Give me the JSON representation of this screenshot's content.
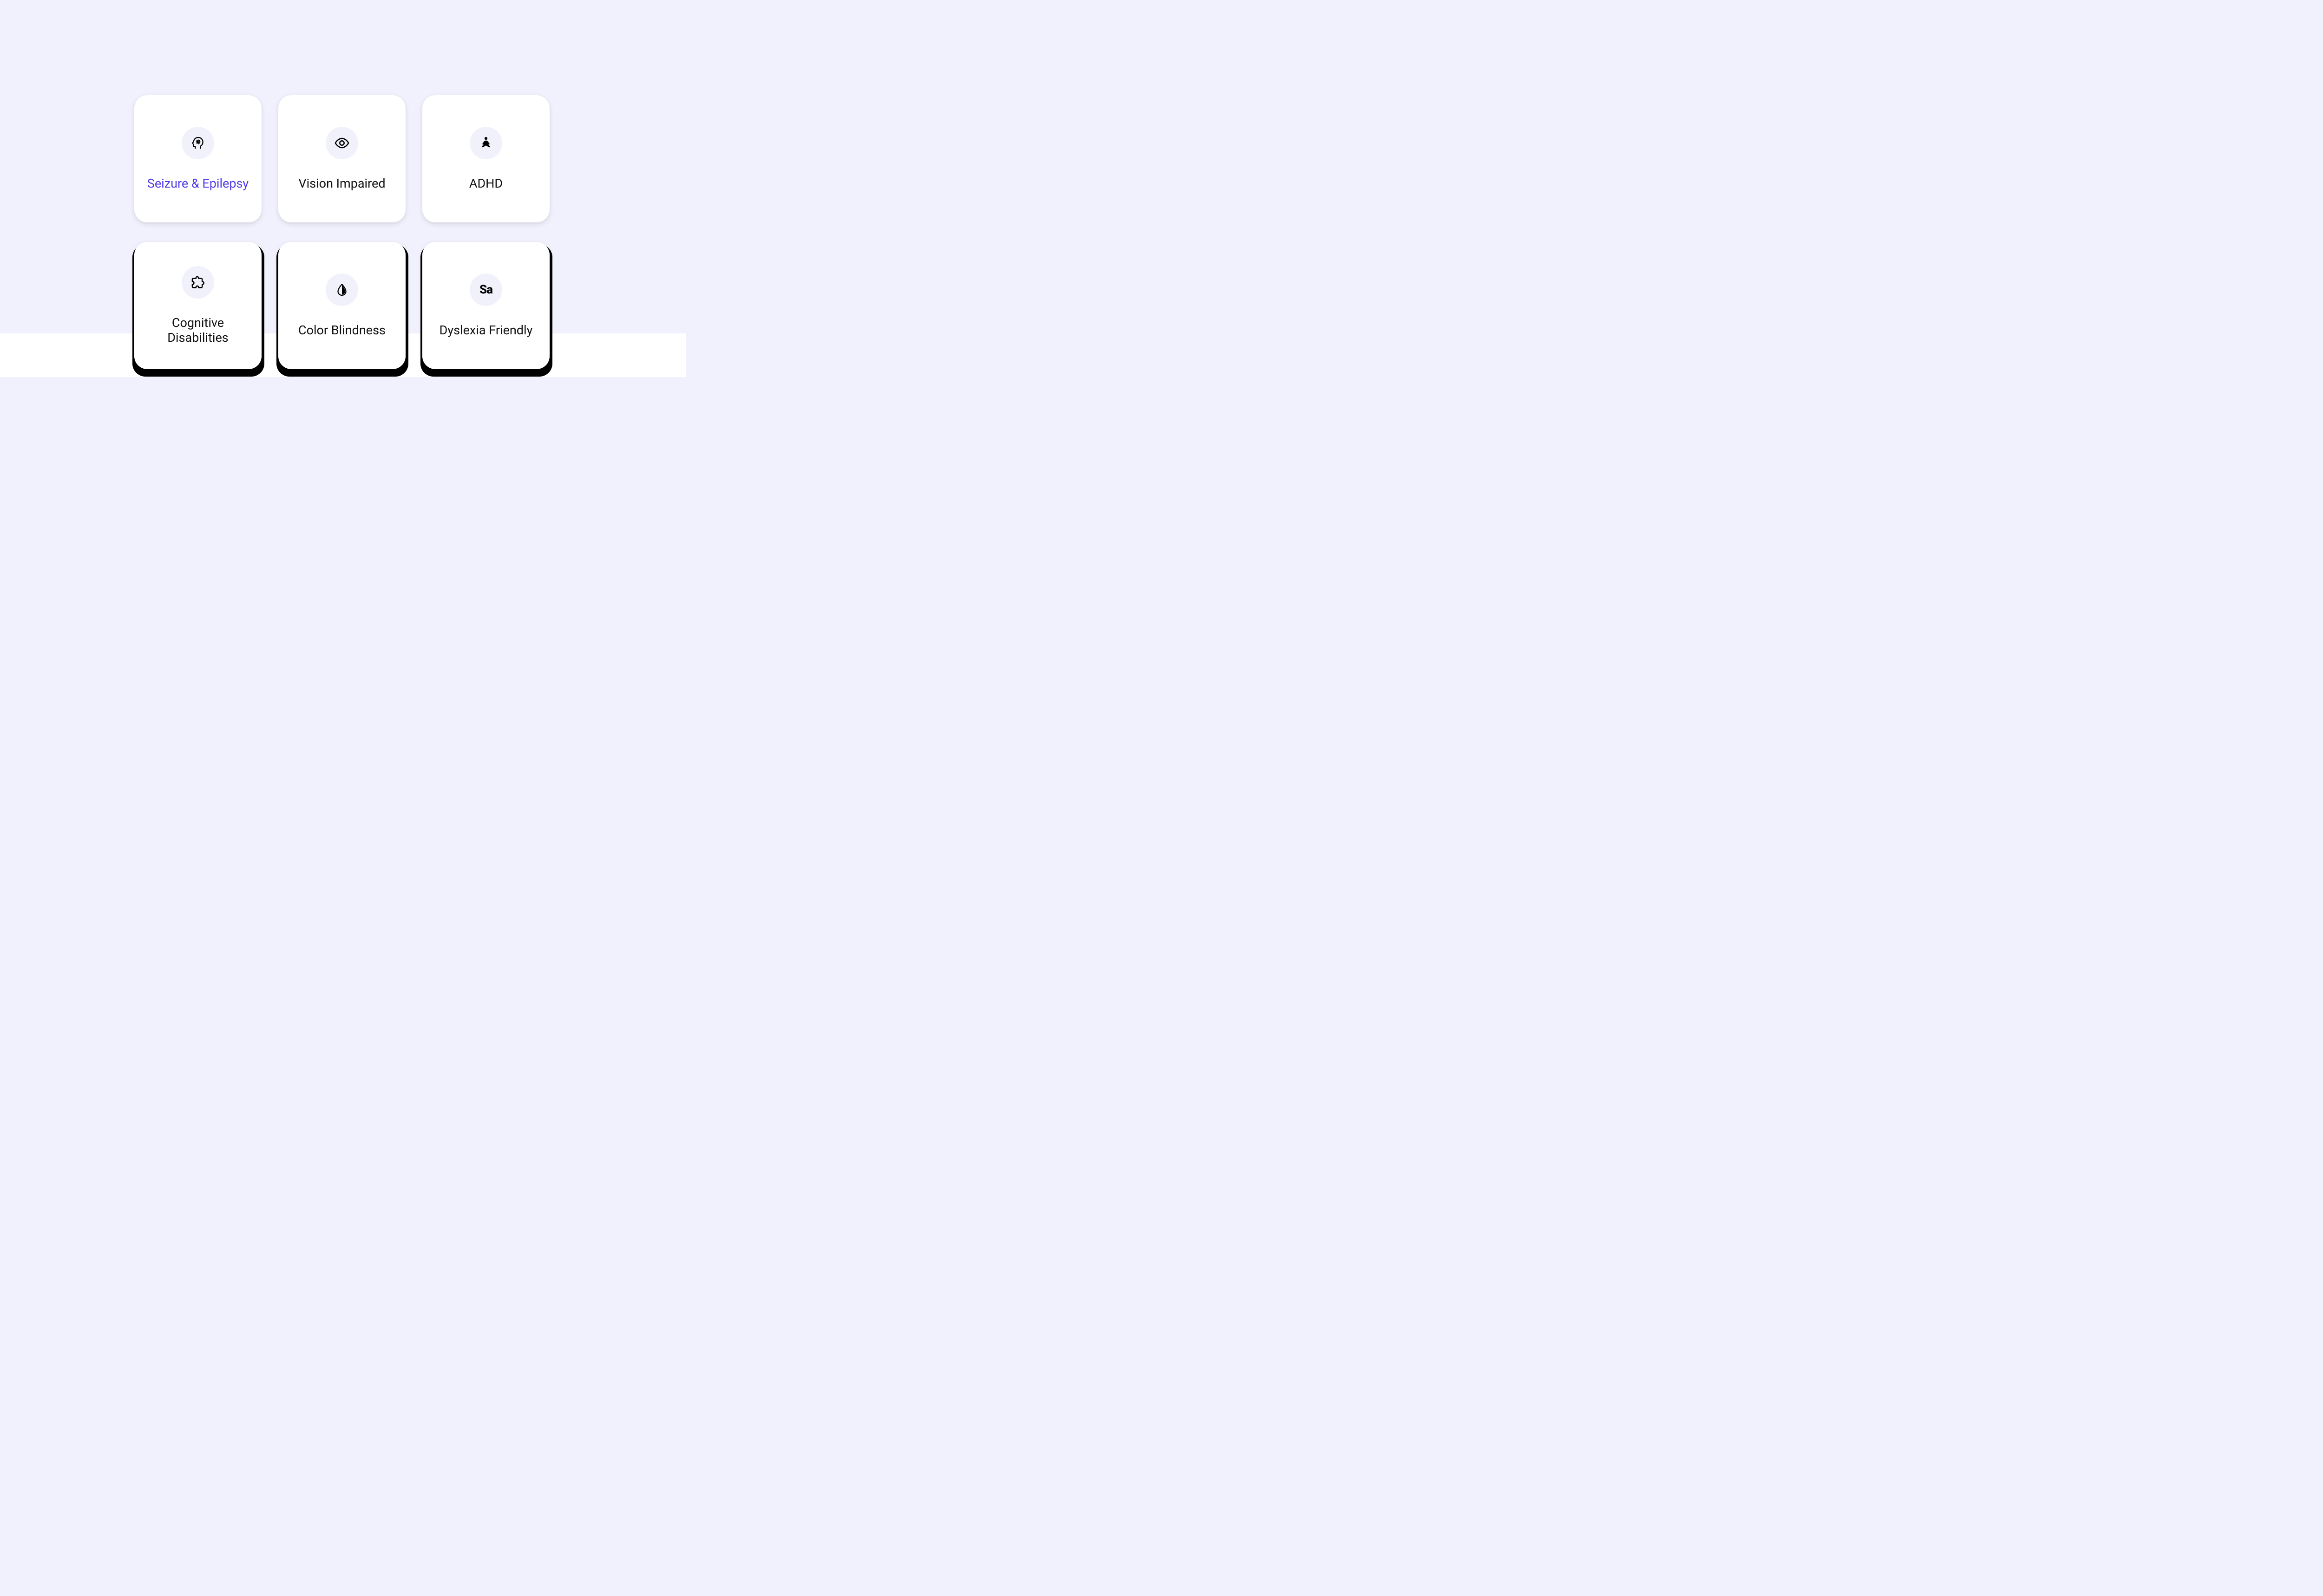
{
  "colors": {
    "background": "#f1f1fe",
    "card_bg": "#ffffff",
    "icon_bg": "#f1f1fc",
    "active": "#4f39e6",
    "text": "#111111"
  },
  "cards": [
    {
      "id": "seizure-epilepsy",
      "label": "Seizure & Epilepsy",
      "icon": "brain-gear-icon",
      "active": true
    },
    {
      "id": "vision-impaired",
      "label": "Vision Impaired",
      "icon": "eye-icon",
      "active": false
    },
    {
      "id": "adhd",
      "label": "ADHD",
      "icon": "meditate-icon",
      "active": false
    },
    {
      "id": "cognitive-disabilities",
      "label": "Cognitive Disabilities",
      "icon": "puzzle-icon",
      "active": false
    },
    {
      "id": "color-blindness",
      "label": "Color Blindness",
      "icon": "contrast-drop-icon",
      "active": false
    },
    {
      "id": "dyslexia-friendly",
      "label": "Dyslexia Friendly",
      "icon": "sa-icon",
      "icon_text": "Sa",
      "active": false
    }
  ]
}
